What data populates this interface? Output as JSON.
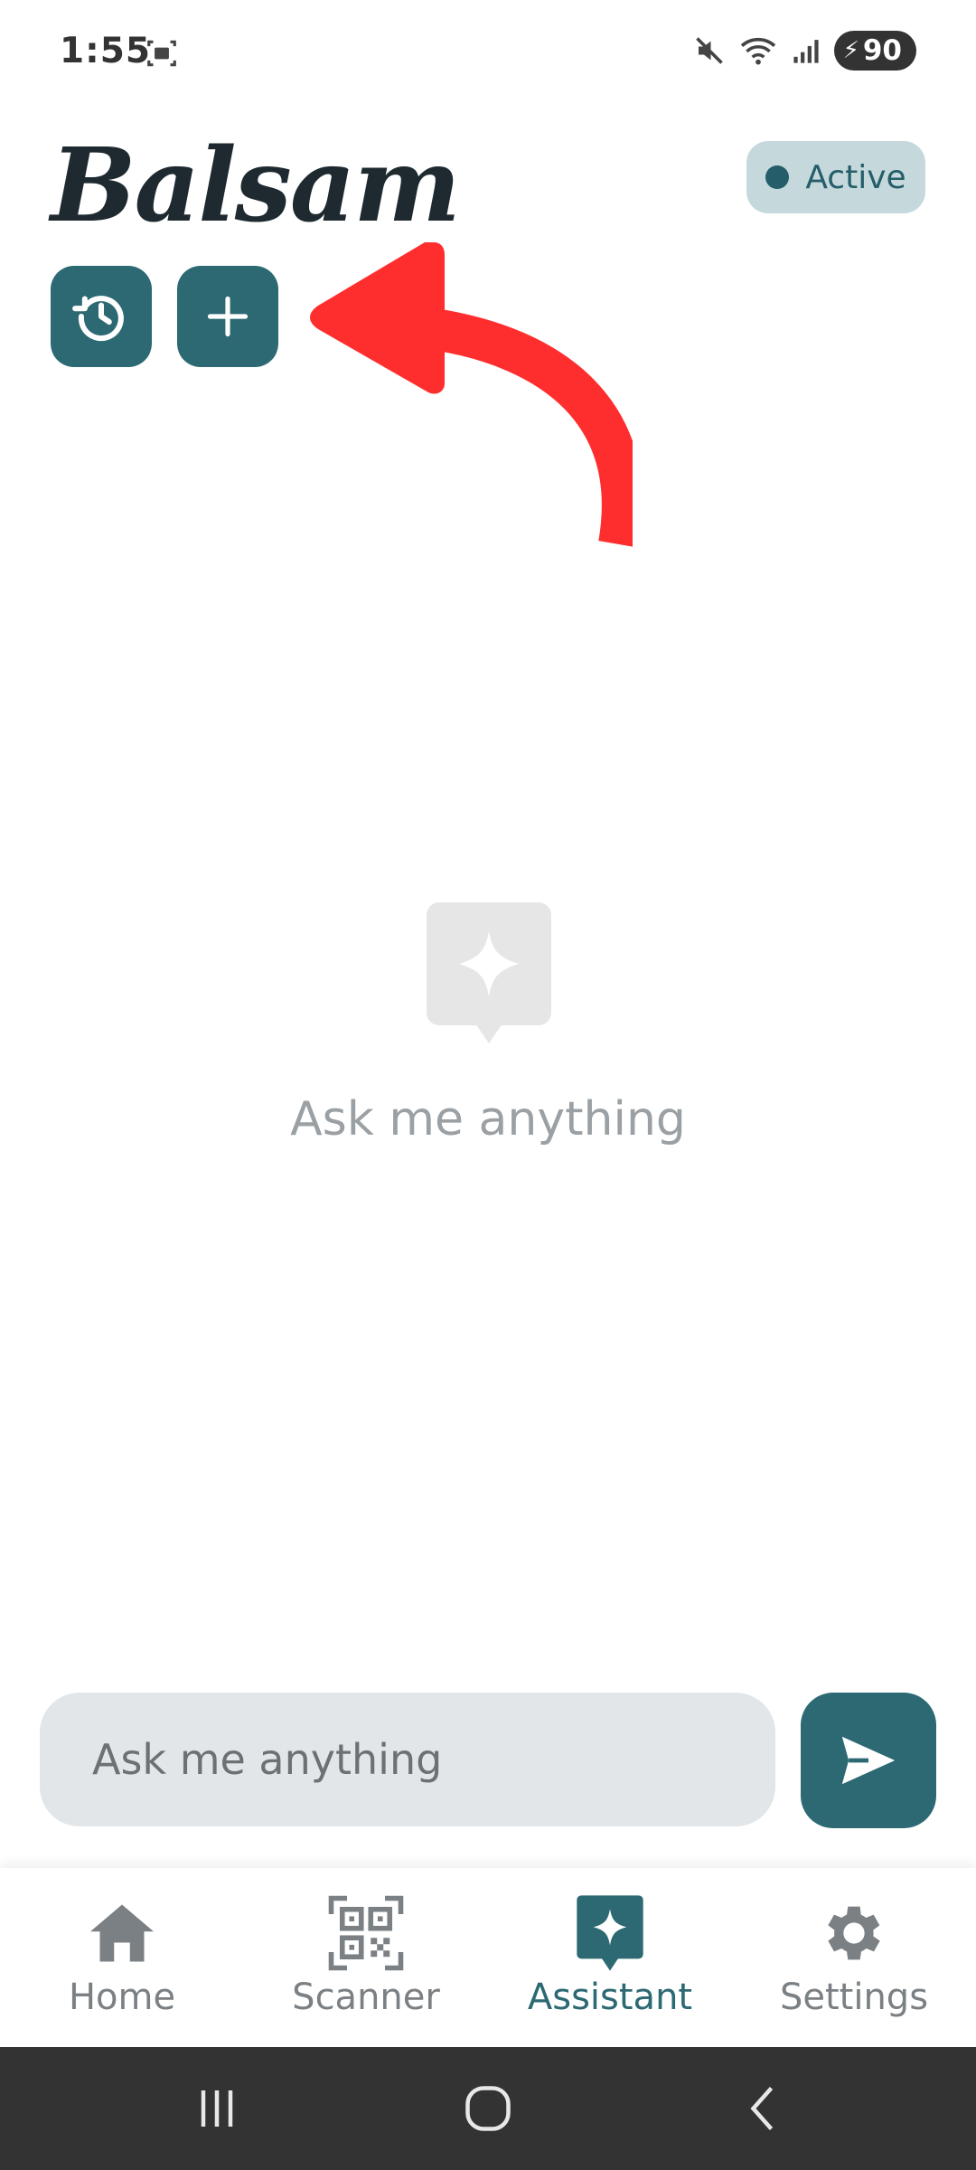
{
  "status_bar": {
    "time": "1:55",
    "battery": "90"
  },
  "header": {
    "app_title": "Balsam",
    "status_label": "Active"
  },
  "empty_state": {
    "message": "Ask me anything"
  },
  "input": {
    "placeholder": "Ask me anything"
  },
  "nav": {
    "items": [
      {
        "label": "Home",
        "icon": "home-icon"
      },
      {
        "label": "Scanner",
        "icon": "qr-code-icon"
      },
      {
        "label": "Assistant",
        "icon": "assistant-sparkle-icon",
        "active": true
      },
      {
        "label": "Settings",
        "icon": "gear-icon"
      }
    ]
  },
  "colors": {
    "primary": "#2c6973",
    "pill_bg": "#c5d9dc",
    "annotation": "#ff2e2e",
    "input_bg": "#e2e6e9",
    "muted_text": "#9aa0a4",
    "system_bar": "#333333"
  }
}
